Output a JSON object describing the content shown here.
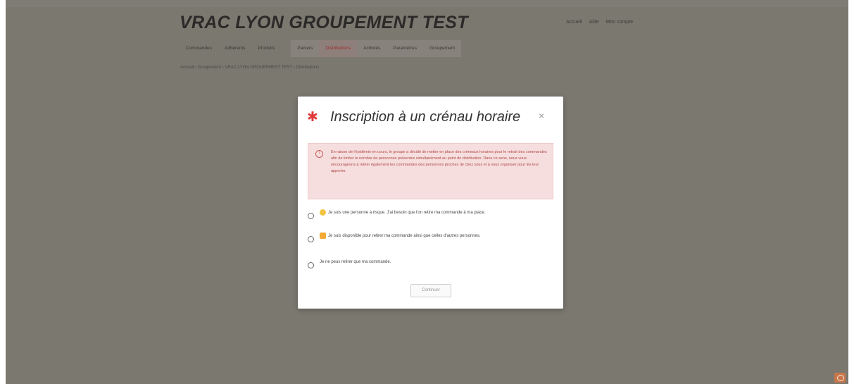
{
  "site": {
    "title": "VRAC LYON GROUPEMENT TEST",
    "top_links": [
      "Accueil",
      "Aide",
      "Mon compte"
    ]
  },
  "menu": {
    "items": [
      {
        "label": "Commandes",
        "icon": "cart-icon"
      },
      {
        "label": "Adhérents",
        "icon": "users-icon"
      },
      {
        "label": "Produits",
        "icon": "box-icon"
      },
      {
        "label": "Paniers",
        "icon": "basket-icon"
      },
      {
        "label": "Distributions",
        "icon": "calendar-icon",
        "active": true
      },
      {
        "label": "Activités",
        "icon": "list-icon"
      },
      {
        "label": "Paramètres",
        "icon": "gear-icon"
      },
      {
        "label": "Groupement",
        "icon": "home-icon"
      }
    ]
  },
  "breadcrumb": "Accueil › Groupement › VRAC LYON GROUPEMENT TEST › Distributions",
  "modal": {
    "title": "Inscription à un crénau horaire",
    "close": "×",
    "alert": "En raison de l'épidémie en cours, le groupe a décidé de mettre en place des créneaux horaires pour le retrait des commandes afin de limiter le nombre de personnes présentes simultanément au point de distribution. Dans ce sens, nous vous encourageons à retirer également les commandes des personnes proches de chez vous et à vous organiser pour les leur apporter.",
    "options": [
      {
        "emoji": "mask-emoji",
        "text": "Je suis une personne à risque. J'ai besoin que l'on retire ma commande à ma place."
      },
      {
        "emoji": "thumbs-up-emoji",
        "text": "Je suis disponible pour retirer ma commande ainsi que celles d'autres personnes."
      },
      {
        "emoji": "",
        "text": "Je ne peux retirer que ma commande."
      }
    ],
    "continue_label": "Continuer"
  },
  "colors": {
    "overlay": "#7b7870",
    "alert_bg": "#f6dede",
    "alert_text": "#b04848",
    "accent": "#e23a3a"
  }
}
